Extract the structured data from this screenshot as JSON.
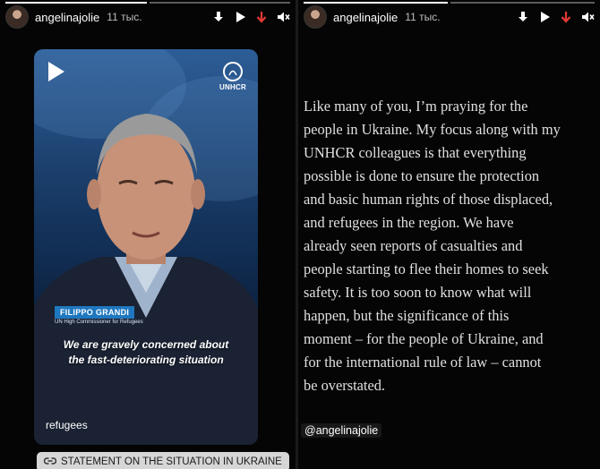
{
  "stories": [
    {
      "header": {
        "username": "angelinajolie",
        "time": "11 тыс.",
        "icons": [
          "download-icon",
          "play-icon",
          "arrow-down-icon",
          "mute-icon"
        ]
      },
      "video": {
        "logo_label": "UNHCR",
        "lower_third_name": "FILIPPO GRANDI",
        "lower_third_title": "UN High Commissioner for Refugees",
        "caption_line1": "We are gravely concerned about",
        "caption_line2": "the fast-deteriorating situation",
        "subtitle": "refugees"
      },
      "link_sticker": {
        "label": "STATEMENT ON THE SITUATION IN UKRAINE",
        "icon": "link-icon"
      }
    },
    {
      "header": {
        "username": "angelinajolie",
        "time": "11 тыс.",
        "icons": [
          "download-icon",
          "play-icon",
          "arrow-down-icon",
          "mute-icon"
        ]
      },
      "text_lines": [
        "Like many of you, I’m praying for the",
        "people in Ukraine. My focus along with my",
        "UNHCR colleagues is that everything",
        "possible is done to ensure the protection",
        "and basic human rights of those displaced,",
        "and refugees in the region. We have",
        "already seen reports of casualties and",
        "people starting to flee their homes to seek",
        "safety. It is too soon to know what will",
        "happen, but the significance of this",
        "moment – for the people of Ukraine, and",
        "for the international rule of law – cannot",
        "be overstated."
      ],
      "mention": "@angelinajolie"
    }
  ],
  "colors": {
    "background": "#000000",
    "download_accent": "#e53935",
    "unhcr_blue": "#1f77bf",
    "sticker_bg": "#d6d6d6"
  }
}
